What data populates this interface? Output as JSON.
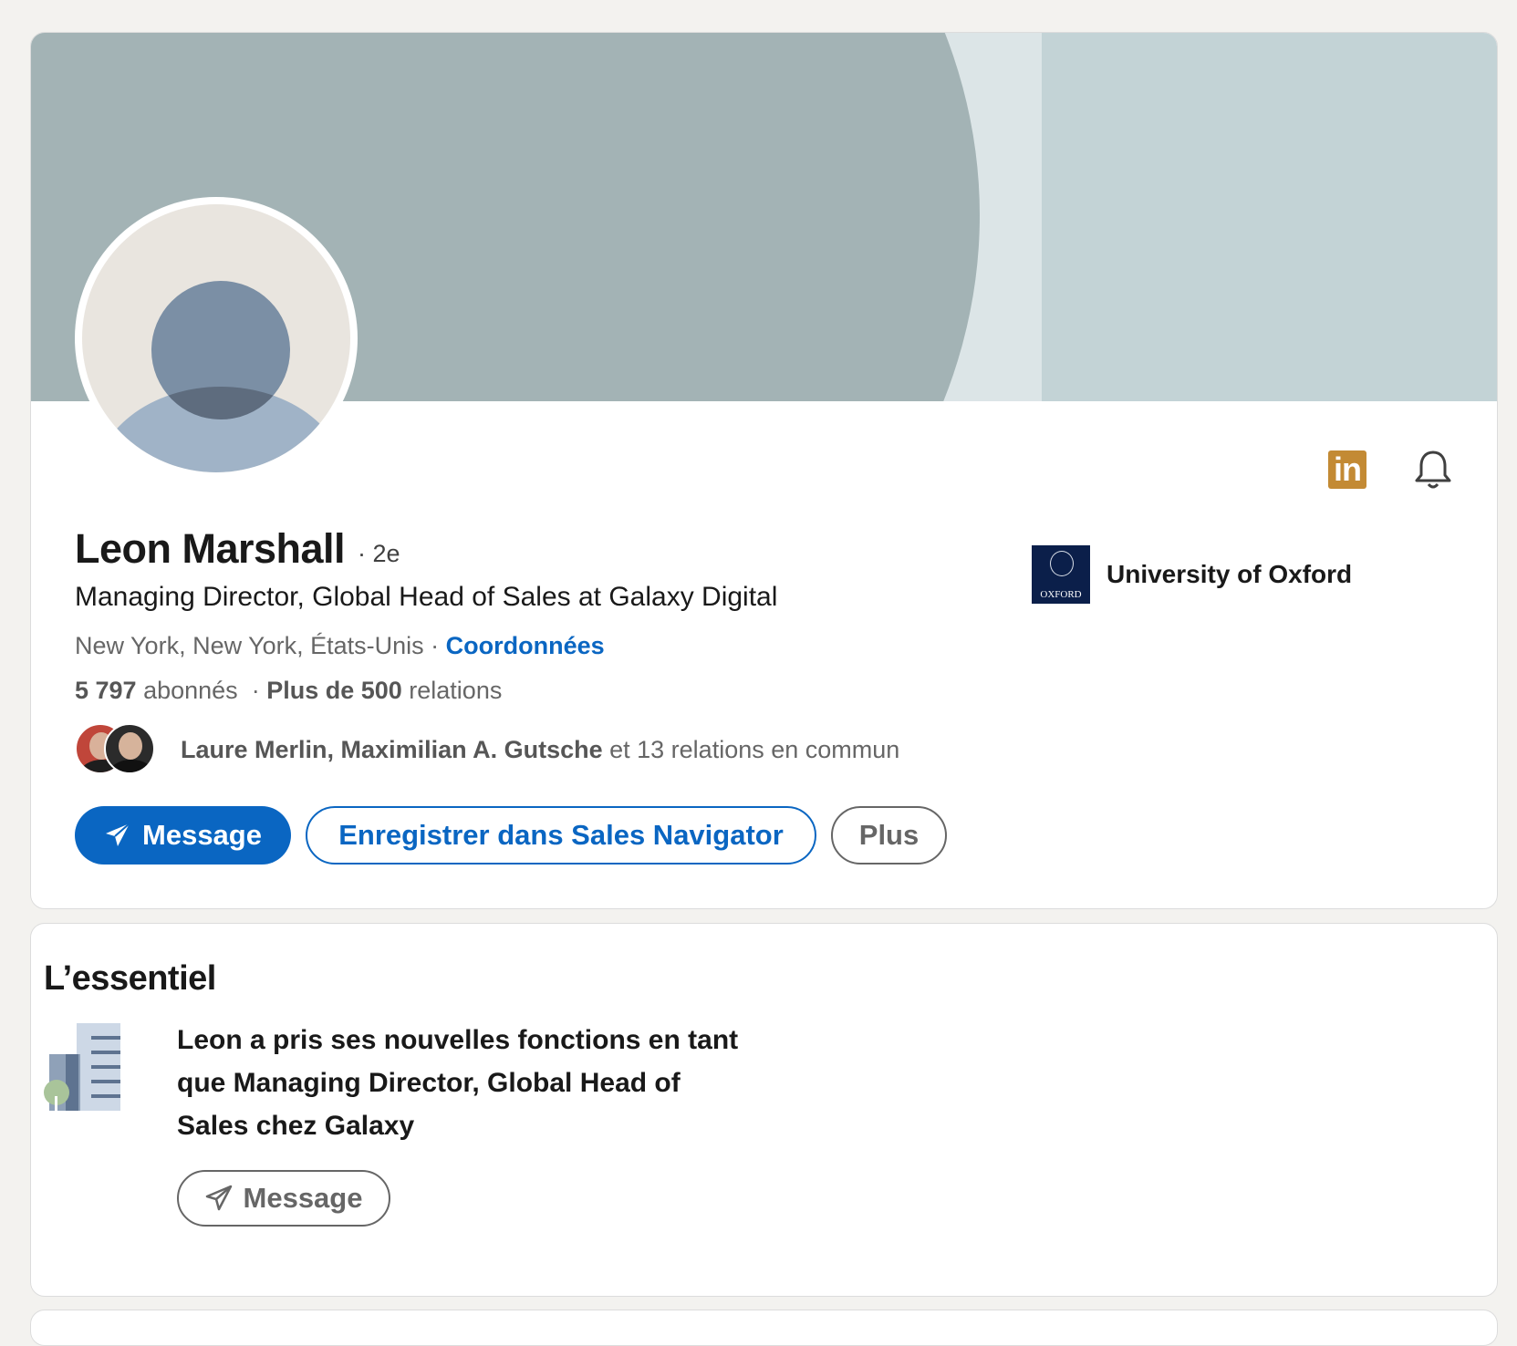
{
  "profile": {
    "name": "Leon Marshall",
    "degree": "· 2e",
    "headline": "Managing Director, Global Head of Sales at Galaxy Digital",
    "location": "New York, New York, États-Unis",
    "location_sep": " · ",
    "contact_link": "Coordonnées",
    "followers_count": "5 797",
    "followers_label": " abonnés",
    "connections_sep": "  · ",
    "connections_count": "Plus de 500",
    "connections_label": " relations",
    "mutual_names": "Laure Merlin, Maximilian A. Gutsche",
    "mutual_rest": " et 13 relations en commun",
    "school": "University of Oxford",
    "school_logo_text": "OXFORD"
  },
  "actions": {
    "message": "Message",
    "save_sales_navigator": "Enregistrer dans Sales Navigator",
    "more": "Plus"
  },
  "icons": {
    "sales_navigator": "linkedin-icon",
    "bell": "bell-icon",
    "send": "send-icon"
  },
  "highlights": {
    "title": "L’essentiel",
    "text": "Leon a pris ses nouvelles fonctions en tant que Managing Director, Global Head of Sales chez Galaxy",
    "message": "Message"
  },
  "colors": {
    "accent": "#0a66c2",
    "sales_nav": "#c38a34",
    "banner": "#a3b3b5"
  }
}
